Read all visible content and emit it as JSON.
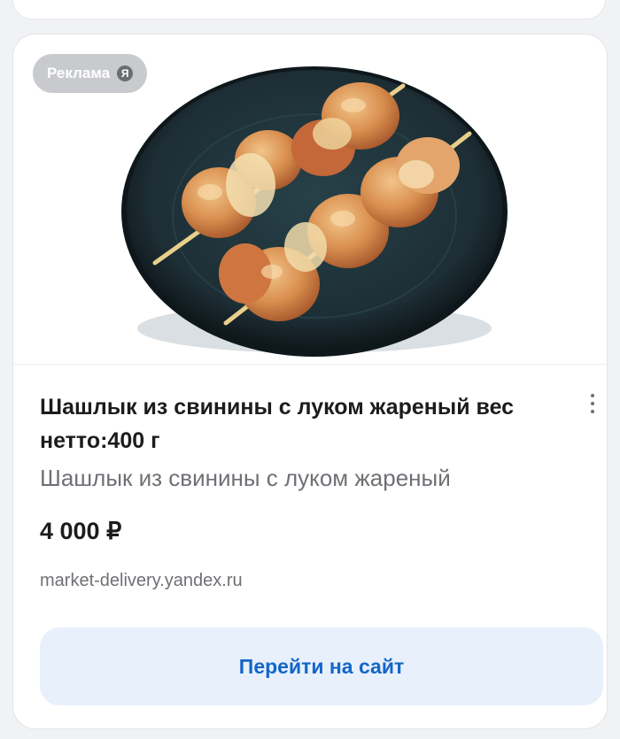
{
  "ad": {
    "badge_label": "Реклама",
    "badge_icon_letter": "Я",
    "title": "Шашлык из свинины с луком жареный вес нетто:400 г",
    "subtitle": "Шашлык из свинины с луком жареный",
    "price": "4 000 ₽",
    "domain": "market-delivery.yandex.ru",
    "cta_label": "Перейти на сайт"
  },
  "colors": {
    "accent": "#1466c8",
    "cta_background": "#e7f0fb",
    "plate": "#1f3038",
    "meat": "#d98f4f"
  }
}
